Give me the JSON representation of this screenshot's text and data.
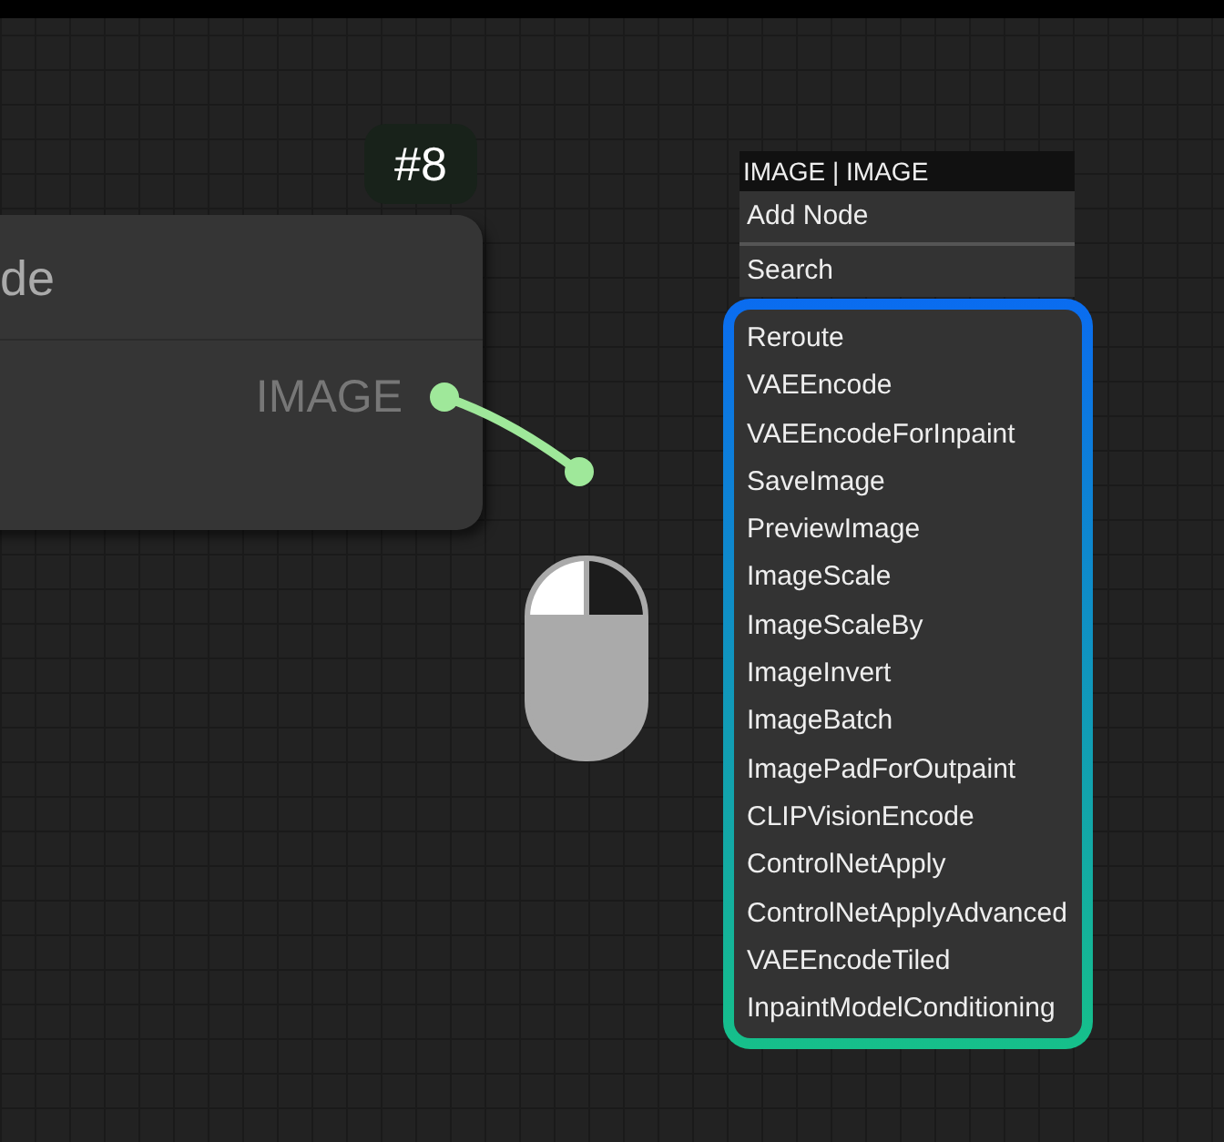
{
  "node": {
    "title": "de",
    "output": "IMAGE",
    "badge": "#8"
  },
  "context_menu": {
    "title": "IMAGE | IMAGE",
    "items": [
      "Add Node",
      "Search"
    ],
    "suggestions": [
      "Reroute",
      "VAEEncode",
      "VAEEncodeForInpaint",
      "SaveImage",
      "PreviewImage",
      "ImageScale",
      "ImageScaleBy",
      "ImageInvert",
      "ImageBatch",
      "ImagePadForOutpaint",
      "CLIPVisionEncode",
      "ControlNetApply",
      "ControlNetApplyAdvanced",
      "VAEEncodeTiled",
      "InpaintModelConditioning"
    ]
  }
}
